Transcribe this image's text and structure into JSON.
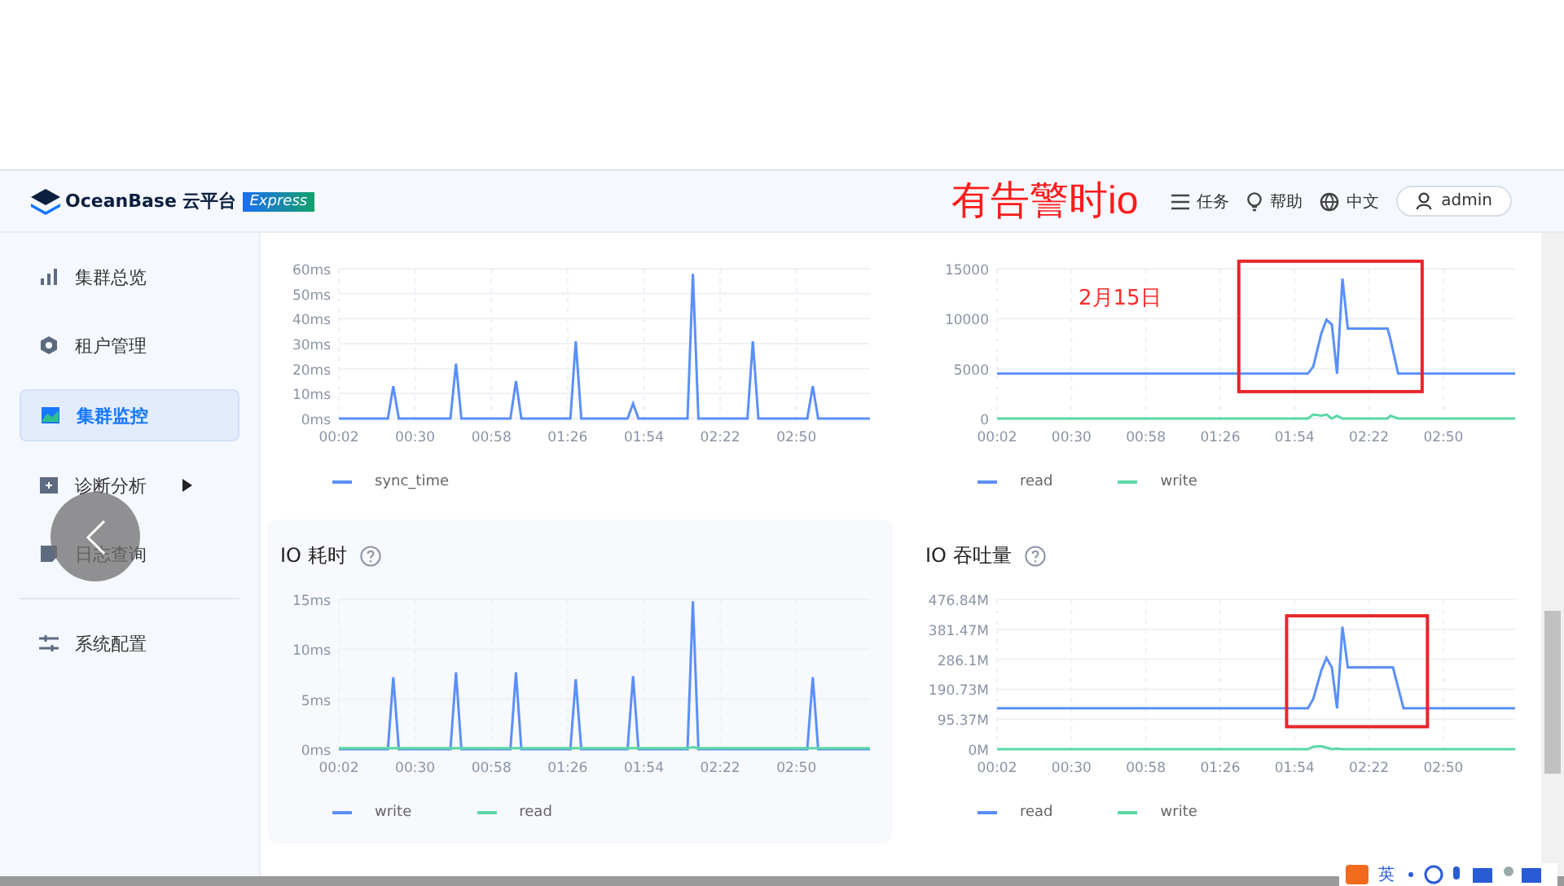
{
  "header": {
    "logo_text": "OceanBase 云平台",
    "edition_badge": "Express",
    "actions": [
      {
        "kind": "tasks",
        "label": "任务"
      },
      {
        "kind": "help",
        "label": "帮助"
      },
      {
        "kind": "language",
        "label": "中文"
      }
    ],
    "user": "admin"
  },
  "sidebar": {
    "sections": [
      {
        "items": [
          {
            "label": "集群总览",
            "selected": false,
            "has_submenu": false
          },
          {
            "label": "租户管理",
            "selected": false,
            "has_submenu": false
          },
          {
            "label": "集群监控",
            "selected": true,
            "has_submenu": false
          },
          {
            "label": "诊断分析",
            "selected": false,
            "has_submenu": true
          },
          {
            "label": "日志查询",
            "selected": false,
            "has_submenu": false
          }
        ]
      },
      {
        "items": [
          {
            "label": "系统配置",
            "selected": false,
            "has_submenu": false
          }
        ]
      }
    ]
  },
  "overlay_note": "有告警时io",
  "panels": [
    {
      "chart_data": {
        "type": "line",
        "grid": true,
        "x": [
          2,
          20,
          22,
          24,
          43,
          45,
          47,
          65,
          67,
          69,
          87,
          89,
          91,
          108,
          110,
          112,
          130,
          132,
          134,
          152,
          154,
          156,
          174,
          176,
          178,
          197
        ],
        "xlim": [
          2,
          197
        ],
        "ylim": [
          0,
          60
        ],
        "xticks": [
          {
            "value": 2,
            "label": "00:02"
          },
          {
            "value": 30,
            "label": "00:30"
          },
          {
            "value": 58,
            "label": "00:58"
          },
          {
            "value": 86,
            "label": "01:26"
          },
          {
            "value": 114,
            "label": "01:54"
          },
          {
            "value": 142,
            "label": "02:22"
          },
          {
            "value": 170,
            "label": "02:50"
          }
        ],
        "yticks": [
          {
            "value": 0,
            "label": "0ms"
          },
          {
            "value": 10,
            "label": "10ms"
          },
          {
            "value": 20,
            "label": "20ms"
          },
          {
            "value": 30,
            "label": "30ms"
          },
          {
            "value": 40,
            "label": "40ms"
          },
          {
            "value": 50,
            "label": "50ms"
          },
          {
            "value": 60,
            "label": "60ms"
          }
        ],
        "series": [
          {
            "name": "sync_time",
            "color": "#5b8ff9",
            "values": [
              0,
              0,
              13,
              0,
              0,
              22,
              0,
              0,
              15,
              0,
              0,
              31,
              0,
              0,
              6,
              0,
              0,
              58,
              0,
              0,
              31,
              0,
              0,
              13,
              0,
              0
            ]
          }
        ]
      }
    },
    {
      "chart_data": {
        "type": "line",
        "grid": true,
        "x": [
          2,
          119,
          121,
          124,
          126,
          128,
          130,
          132,
          134,
          149,
          150,
          153,
          197
        ],
        "xlim": [
          2,
          197
        ],
        "ylim": [
          0,
          15000
        ],
        "xticks": [
          {
            "value": 2,
            "label": "00:02"
          },
          {
            "value": 30,
            "label": "00:30"
          },
          {
            "value": 58,
            "label": "00:58"
          },
          {
            "value": 86,
            "label": "01:26"
          },
          {
            "value": 114,
            "label": "01:54"
          },
          {
            "value": 142,
            "label": "02:22"
          },
          {
            "value": 170,
            "label": "02:50"
          }
        ],
        "yticks": [
          0,
          5000,
          10000,
          15000
        ],
        "series": [
          {
            "name": "read",
            "color": "#5b8ff9",
            "values": [
              4500,
              4500,
              5200,
              8500,
              9900,
              9400,
              4500,
              14000,
              9000,
              9000,
              8000,
              4500,
              4500
            ]
          },
          {
            "name": "write",
            "color": "#5ad8a6",
            "values": [
              0,
              0,
              400,
              300,
              400,
              0,
              300,
              0,
              0,
              0,
              300,
              0,
              0
            ]
          }
        ],
        "annotations": [
          "2月15日"
        ]
      }
    },
    {
      "title": "IO 耗时",
      "chart_data": {
        "type": "line",
        "grid": true,
        "x": [
          2,
          20,
          22,
          24,
          43,
          45,
          47,
          65,
          67,
          69,
          87,
          89,
          91,
          108,
          110,
          112,
          130,
          132,
          134,
          174,
          176,
          178,
          197
        ],
        "xlim": [
          2,
          197
        ],
        "ylim": [
          0,
          15
        ],
        "xticks": [
          {
            "value": 2,
            "label": "00:02"
          },
          {
            "value": 30,
            "label": "00:30"
          },
          {
            "value": 58,
            "label": "00:58"
          },
          {
            "value": 86,
            "label": "01:26"
          },
          {
            "value": 114,
            "label": "01:54"
          },
          {
            "value": 142,
            "label": "02:22"
          },
          {
            "value": 170,
            "label": "02:50"
          }
        ],
        "yticks": [
          {
            "value": 0,
            "label": "0ms"
          },
          {
            "value": 5,
            "label": "5ms"
          },
          {
            "value": 10,
            "label": "10ms"
          },
          {
            "value": 15,
            "label": "15ms"
          }
        ],
        "series": [
          {
            "name": "write",
            "color": "#5b8ff9",
            "values": [
              0,
              0,
              7.2,
              0,
              0,
              7.7,
              0,
              0,
              7.7,
              0,
              0,
              7,
              0,
              0,
              7.3,
              0,
              0,
              14.8,
              0,
              0,
              7.2,
              0,
              0
            ]
          },
          {
            "name": "read",
            "color": "#5ad8a6",
            "values": [
              0.1,
              0.1,
              0.1,
              0.1,
              0.1,
              0.1,
              0.1,
              0.1,
              0.1,
              0.1,
              0.1,
              0.1,
              0.1,
              0.1,
              0.1,
              0.1,
              0.1,
              0.2,
              0.1,
              0.1,
              0.1,
              0.1,
              0.1
            ]
          }
        ]
      }
    },
    {
      "title": "IO 吞吐量",
      "chart_data": {
        "type": "line",
        "grid": true,
        "x": [
          2,
          119,
          121,
          124,
          126,
          128,
          130,
          132,
          134,
          151,
          155,
          197
        ],
        "xlim": [
          2,
          197
        ],
        "ylim": [
          0,
          476.84
        ],
        "xticks": [
          {
            "value": 2,
            "label": "00:02"
          },
          {
            "value": 30,
            "label": "00:30"
          },
          {
            "value": 58,
            "label": "00:58"
          },
          {
            "value": 86,
            "label": "01:26"
          },
          {
            "value": 114,
            "label": "01:54"
          },
          {
            "value": 142,
            "label": "02:22"
          },
          {
            "value": 170,
            "label": "02:50"
          }
        ],
        "yticks": [
          {
            "value": 0,
            "label": "0M"
          },
          {
            "value": 95.37,
            "label": "95.37M"
          },
          {
            "value": 190.73,
            "label": "190.73M"
          },
          {
            "value": 286.1,
            "label": "286.1M"
          },
          {
            "value": 381.47,
            "label": "381.47M"
          },
          {
            "value": 476.84,
            "label": "476.84M"
          }
        ],
        "series": [
          {
            "name": "read",
            "color": "#5b8ff9",
            "values": [
              130,
              130,
              160,
              250,
              290,
              260,
              130,
              390,
              260,
              260,
              130,
              130
            ]
          },
          {
            "name": "write",
            "color": "#5ad8a6",
            "values": [
              0,
              0,
              8,
              10,
              5,
              0,
              2,
              0,
              0,
              0,
              0,
              0
            ]
          }
        ]
      }
    }
  ],
  "ime_toolbar": {
    "label": "英"
  }
}
